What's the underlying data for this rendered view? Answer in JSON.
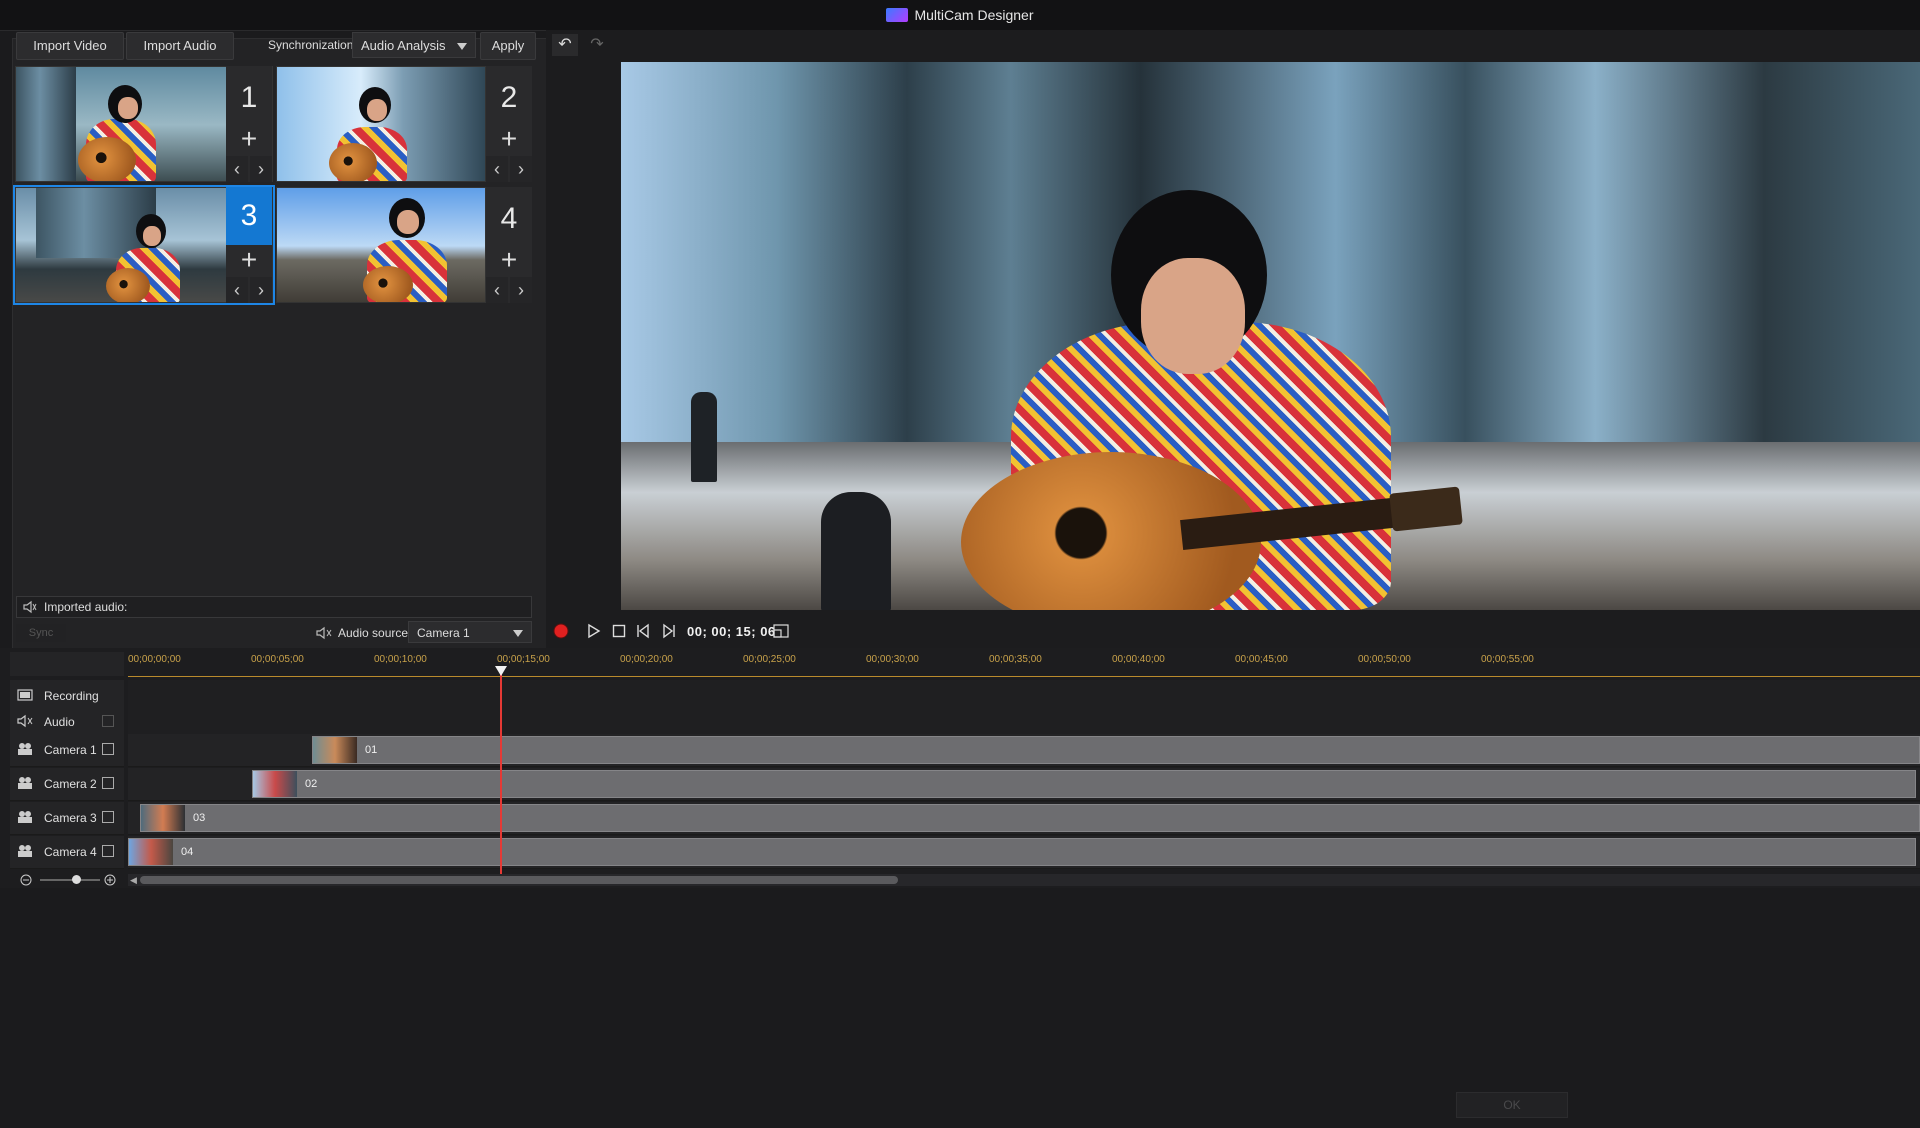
{
  "window": {
    "title": "MultiCam Designer"
  },
  "toolbar": {
    "import_video": "Import Video",
    "import_audio": "Import Audio",
    "sync_label": "Synchronization:",
    "sync_value": "Audio Analysis",
    "apply": "Apply"
  },
  "cameras": [
    {
      "number": "1",
      "add": "+",
      "prev": "‹",
      "next": "›",
      "active": false
    },
    {
      "number": "2",
      "add": "+",
      "prev": "‹",
      "next": "›",
      "active": false
    },
    {
      "number": "3",
      "add": "+",
      "prev": "‹",
      "next": "›",
      "active": true
    },
    {
      "number": "4",
      "add": "+",
      "prev": "‹",
      "next": "›",
      "active": false
    }
  ],
  "imported_audio": {
    "label": "Imported audio:"
  },
  "audio_source": {
    "label": "Audio source:",
    "value": "Camera 1",
    "left_button": "Sync"
  },
  "transport": {
    "timecode": "00; 00; 15; 06"
  },
  "timeline": {
    "ruler": [
      "00;00;00;00",
      "00;00;05;00",
      "00;00;10;00",
      "00;00;15;00",
      "00;00;20;00",
      "00;00;25;00",
      "00;00;30;00",
      "00;00;35;00",
      "00;00;40;00",
      "00;00;45;00",
      "00;00;50;00",
      "00;00;55;00"
    ],
    "tracks": [
      {
        "label": "Recording",
        "icon": "film-icon"
      },
      {
        "label": "Audio",
        "icon": "speaker-icon"
      },
      {
        "label": "Camera 1",
        "icon": "camera-people-icon",
        "clip": "01"
      },
      {
        "label": "Camera 2",
        "icon": "camera-people-icon",
        "clip": "02"
      },
      {
        "label": "Camera 3",
        "icon": "camera-people-icon",
        "clip": "03"
      },
      {
        "label": "Camera 4",
        "icon": "camera-people-icon",
        "clip": "04"
      }
    ]
  },
  "footer": {
    "ok": "OK"
  },
  "colors": {
    "accent": "#1478d2",
    "playhead": "#e53935",
    "ruler": "#c8a24a",
    "record": "#e02020"
  }
}
